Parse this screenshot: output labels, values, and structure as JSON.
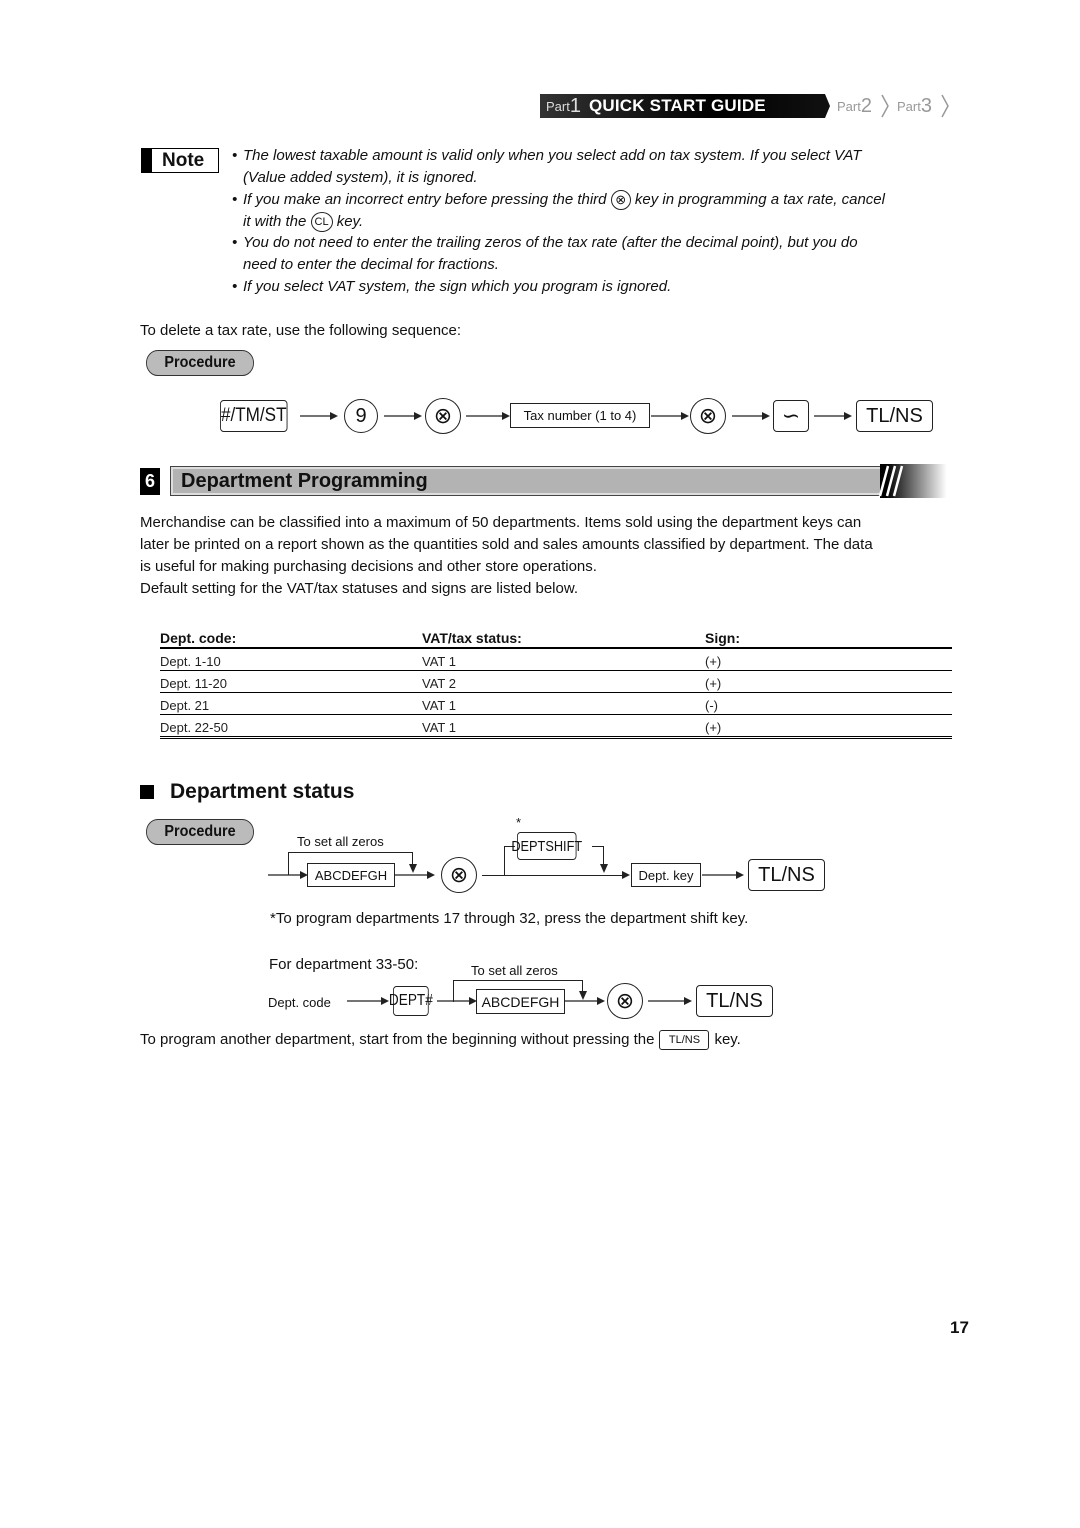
{
  "header": {
    "part1_word": "Part",
    "part1_num": "1",
    "part1_title": "QUICK START GUIDE",
    "part2_word": "Part",
    "part2_num": "2",
    "part3_word": "Part",
    "part3_num": "3"
  },
  "note": {
    "label": "Note",
    "items": [
      {
        "bullet": "•",
        "text1": "The lowest taxable amount is valid only when you select add on tax system. If you select VAT",
        "text2": "(Value added system), it is ignored."
      },
      {
        "bullet": "•",
        "text1a": "If you make an incorrect entry before pressing the third",
        "key1": "⊗",
        "text1b": "key in programming a tax rate, cancel",
        "text2a": "it with the",
        "key2": "CL",
        "text2b": "key."
      },
      {
        "bullet": "•",
        "text1": "You do not need to enter the trailing zeros of the tax rate (after the decimal point), but you do",
        "text2": "need to enter the decimal for fractions."
      },
      {
        "bullet": "•",
        "text1": "If you select VAT system, the sign which you program is ignored."
      }
    ]
  },
  "delete_intro": "To delete a tax rate, use the following sequence:",
  "procedure_label": "Procedure",
  "delete_sequence": {
    "key_tmst": "#/TM/ST",
    "key_9": "9",
    "key_x": "⊗",
    "box_tax": "Tax number (1 to 4)",
    "key_x2": "⊗",
    "key_void": "∽",
    "key_tlns": "TL/NS"
  },
  "section": {
    "number": "6",
    "title": "Department Programming"
  },
  "intro_paragraph": [
    "Merchandise can be classified into a maximum of 50 departments.  Items sold using the department keys can",
    "later be printed on a report shown as the quantities sold and sales amounts classified by department.  The data",
    "is useful for making purchasing decisions and other store operations.",
    "Default setting for the VAT/tax statuses and signs are listed below."
  ],
  "table": {
    "headers": [
      "Dept. code:",
      "VAT/tax status:",
      "Sign:"
    ],
    "rows": [
      [
        "Dept. 1-10",
        "VAT 1",
        "(+)"
      ],
      [
        "Dept. 11-20",
        "VAT 2",
        "(+)"
      ],
      [
        "Dept. 21",
        "VAT 1",
        "(-)"
      ],
      [
        "Dept. 22-50",
        "VAT 1",
        "(+)"
      ]
    ]
  },
  "dept_status": {
    "title": "Department status",
    "procedure_label": "Procedure",
    "set_zeros": "To set all zeros",
    "box_abc": "ABCDEFGH",
    "key_x": "⊗",
    "asterisk": "*",
    "key_deptshift": "DEPTSHIFT",
    "box_deptkey": "Dept. key",
    "key_tlns": "TL/NS",
    "footnote": "*To program departments 17 through 32, press the department shift key.",
    "for_dept": "For department 33-50:",
    "set_zeros2": "To set all zeros",
    "dept_code": "Dept. code",
    "key_dept_num": "DEPT#",
    "box_abc2": "ABCDEFGH",
    "key_x2": "⊗",
    "key_tlns2": "TL/NS",
    "another_a": "To program another department, start from the beginning without pressing the",
    "another_key": "TL/NS",
    "another_b": "key."
  },
  "page_number": "17"
}
